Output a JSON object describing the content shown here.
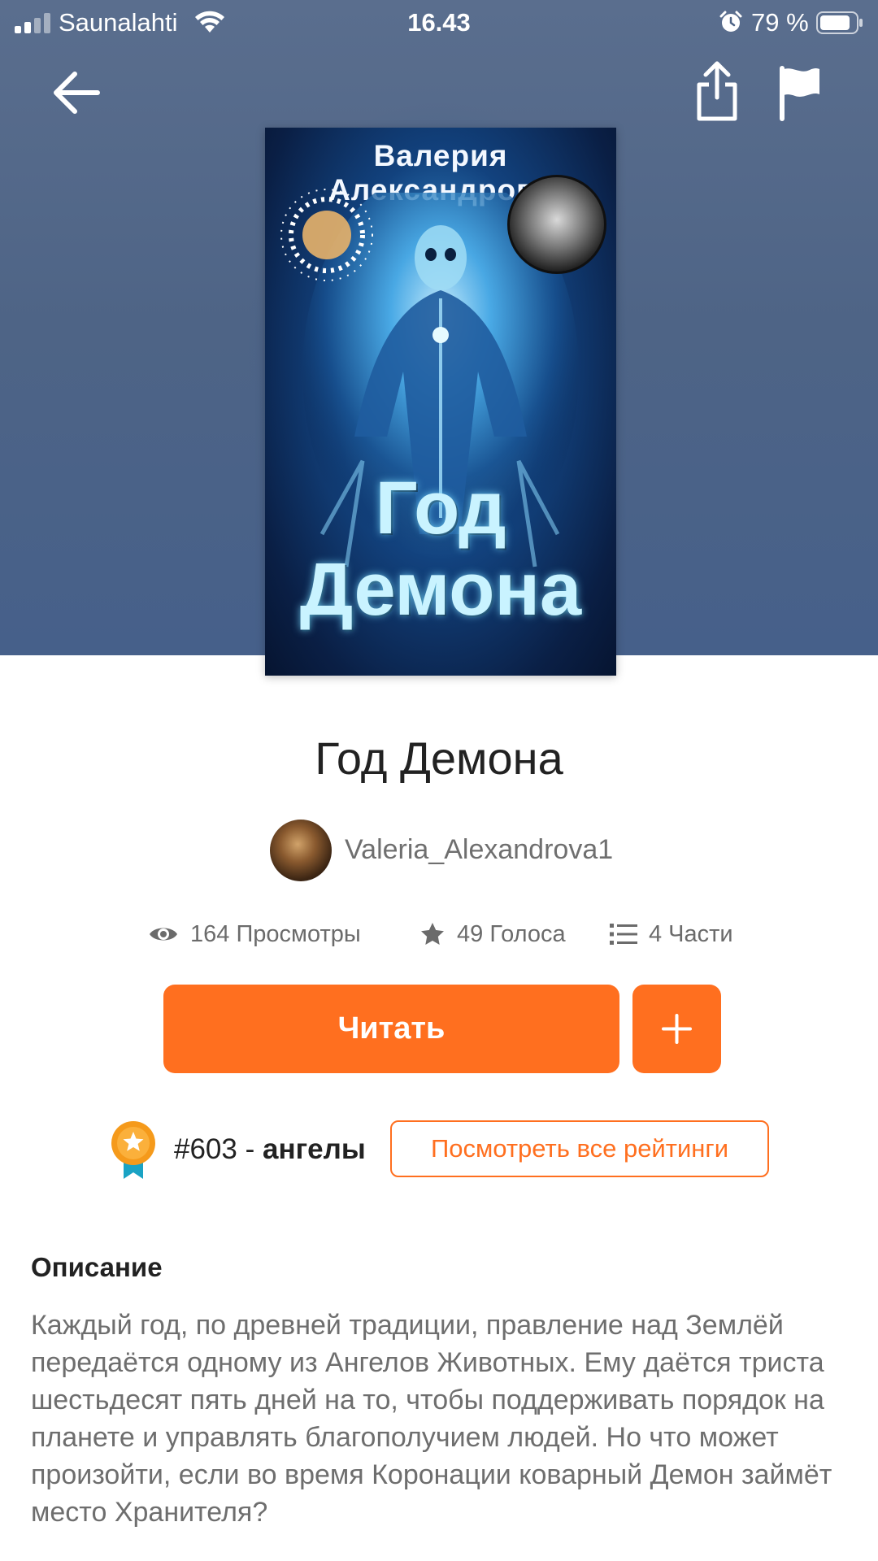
{
  "status_bar": {
    "carrier": "Saunalahti",
    "time": "16.43",
    "battery": "79 %",
    "icons": [
      "signal-icon",
      "wifi-icon",
      "alarm-icon",
      "battery-icon"
    ]
  },
  "nav": {
    "icons": [
      "back-arrow-icon",
      "share-icon",
      "flag-icon"
    ]
  },
  "cover": {
    "author_text": "Валерия Александрова",
    "title_line1": "Год",
    "title_line2": "Демона"
  },
  "book": {
    "title": "Год Демона",
    "author": "Valeria_Alexandrova1"
  },
  "stats": {
    "views": "164 Просмотры",
    "votes": "49 Голоса",
    "parts": "4 Части"
  },
  "actions": {
    "read_label": "Читать",
    "add_icon": "plus-icon"
  },
  "ranking": {
    "rank": "#603",
    "separator": " - ",
    "category": "ангелы",
    "view_all_label": "Посмотреть все рейтинги"
  },
  "description": {
    "heading": "Описание",
    "text": "Каждый год, по древней традиции, правление над Землёй передаётся одному из Ангелов Животных. Ему даётся триста шестьдесят пять дней на то, чтобы поддерживать порядок на планете и управлять благополучием людей. Но что может произойти, если во время Коронации коварный Демон займёт место Хранителя?"
  },
  "colors": {
    "accent": "#ff6f1f",
    "hero_bg": "#4e6486",
    "text_dark": "#222222",
    "text_muted": "#6e6e6e"
  }
}
